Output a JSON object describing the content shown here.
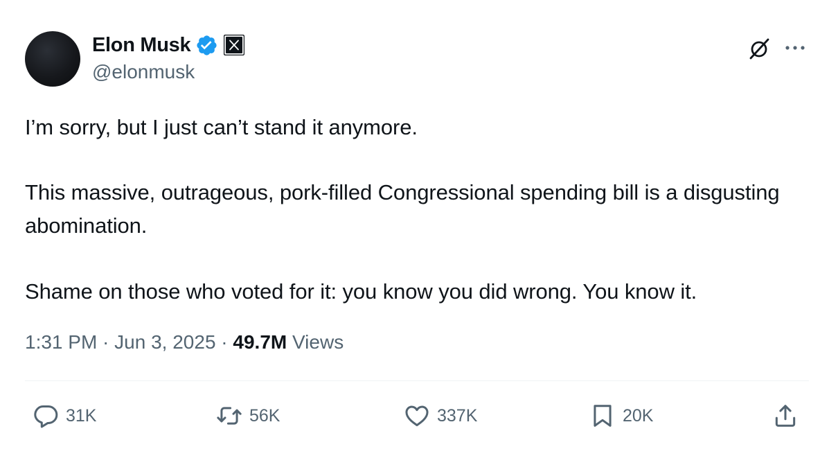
{
  "author": {
    "display_name": "Elon Musk",
    "handle": "@elonmusk",
    "verified_icon": "verified-badge-icon",
    "affiliation_icon": "x-logo-icon"
  },
  "header_actions": {
    "grok_icon": "grok-icon",
    "more_icon": "more-options-icon"
  },
  "tweet": {
    "paragraphs": [
      "I’m sorry, but I just can’t stand it anymore.",
      "This massive, outrageous, pork-filled Congressional spending bill is a disgusting abomination.",
      "Shame on those who voted for it: you know you did wrong. You know it."
    ]
  },
  "meta": {
    "time": "1:31 PM",
    "separator": " · ",
    "date": "Jun 3, 2025",
    "views_count": "49.7M",
    "views_label": " Views"
  },
  "actions": {
    "reply_count": "31K",
    "repost_count": "56K",
    "like_count": "337K",
    "bookmark_count": "20K"
  },
  "colors": {
    "text_primary": "#0f1419",
    "text_secondary": "#536471",
    "verified_blue": "#1d9bf0",
    "divider": "#eff3f4"
  }
}
